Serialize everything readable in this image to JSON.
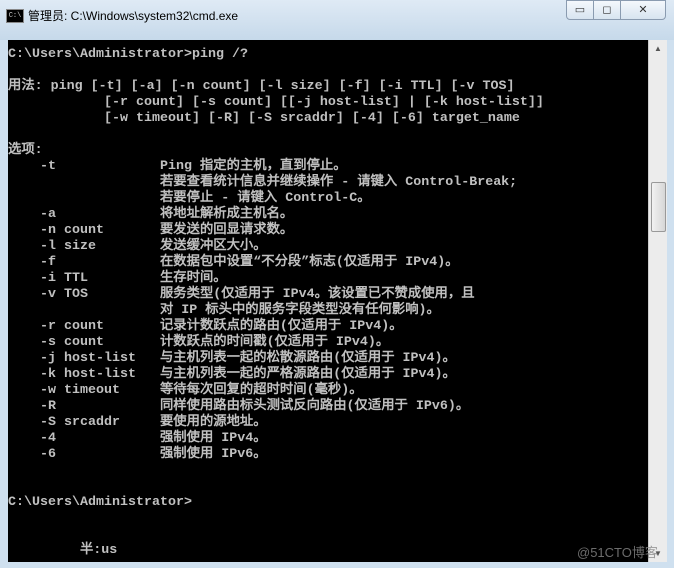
{
  "window": {
    "title": "管理员: C:\\Windows\\system32\\cmd.exe",
    "app_icon_text": "C:\\",
    "minimize_glyph": "▭",
    "maximize_glyph": "◻",
    "close_glyph": "✕"
  },
  "console": {
    "lines": [
      "C:\\Users\\Administrator>ping /?",
      "",
      "用法: ping [-t] [-a] [-n count] [-l size] [-f] [-i TTL] [-v TOS]",
      "            [-r count] [-s count] [[-j host-list] | [-k host-list]]",
      "            [-w timeout] [-R] [-S srcaddr] [-4] [-6] target_name",
      "",
      "选项:",
      "    -t             Ping 指定的主机，直到停止。",
      "                   若要查看统计信息并继续操作 - 请键入 Control-Break;",
      "                   若要停止 - 请键入 Control-C。",
      "    -a             将地址解析成主机名。",
      "    -n count       要发送的回显请求数。",
      "    -l size        发送缓冲区大小。",
      "    -f             在数据包中设置“不分段”标志(仅适用于 IPv4)。",
      "    -i TTL         生存时间。",
      "    -v TOS         服务类型(仅适用于 IPv4。该设置已不赞成使用，且",
      "                   对 IP 标头中的服务字段类型没有任何影响)。",
      "    -r count       记录计数跃点的路由(仅适用于 IPv4)。",
      "    -s count       计数跃点的时间戳(仅适用于 IPv4)。",
      "    -j host-list   与主机列表一起的松散源路由(仅适用于 IPv4)。",
      "    -k host-list   与主机列表一起的严格源路由(仅适用于 IPv4)。",
      "    -w timeout     等待每次回复的超时时间(毫秒)。",
      "    -R             同样使用路由标头测试反向路由(仅适用于 IPv6)。",
      "    -S srcaddr     要使用的源地址。",
      "    -4             强制使用 IPv4。",
      "    -6             强制使用 IPv6。",
      "",
      "",
      "C:\\Users\\Administrator>",
      "",
      "",
      "         半:us"
    ]
  },
  "scrollbar": {
    "up_glyph": "▲",
    "down_glyph": "▼"
  },
  "watermark": "@51CTO博客"
}
